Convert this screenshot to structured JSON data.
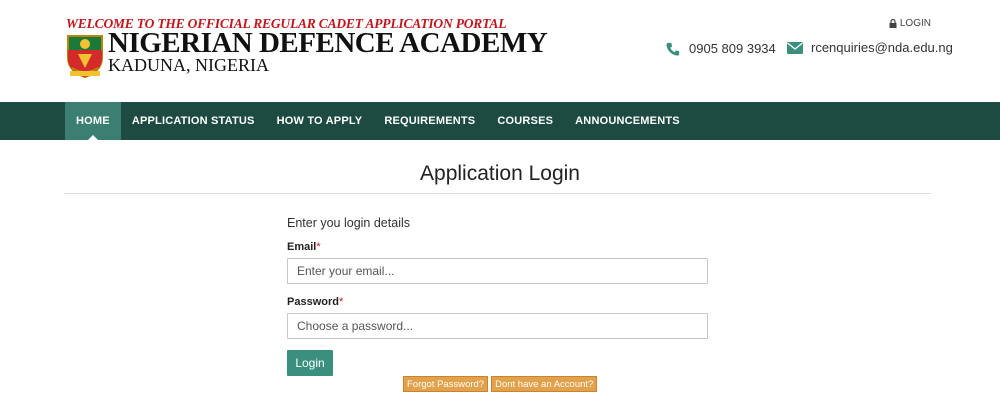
{
  "header": {
    "tagline": "WELCOME TO THE OFFICIAL REGULAR CADET APPLICATION PORTAL",
    "academy_name": "NIGERIAN DEFENCE ACADEMY",
    "location": "KADUNA, NIGERIA",
    "login_link": "LOGIN",
    "phone": "0905 809 3934",
    "email": "rcenquiries@nda.edu.ng"
  },
  "nav": {
    "items": [
      {
        "label": "HOME",
        "active": true
      },
      {
        "label": "APPLICATION STATUS",
        "active": false
      },
      {
        "label": "HOW TO APPLY",
        "active": false
      },
      {
        "label": "REQUIREMENTS",
        "active": false
      },
      {
        "label": "COURSES",
        "active": false
      },
      {
        "label": "ANNOUNCEMENTS",
        "active": false
      }
    ]
  },
  "page": {
    "title": "Application Login",
    "instruction": "Enter you login details"
  },
  "form": {
    "email_label": "Email",
    "email_placeholder": "Enter your email...",
    "email_value": "",
    "password_label": "Password",
    "password_placeholder": "Choose a password...",
    "password_value": "",
    "required_marker": "*",
    "login_button": "Login",
    "forgot_password": "Forgot Password?",
    "no_account": "Dont have an Account?"
  },
  "colors": {
    "nav_bg": "#1d4b41",
    "nav_active": "#3a7f71",
    "button_primary": "#3b8f7f",
    "button_warning": "#e2a14a",
    "tagline_red": "#c0171c"
  },
  "icons": {
    "lock": "lock-icon",
    "phone": "phone-icon",
    "email": "envelope-icon",
    "crest": "nda-crest-logo"
  }
}
